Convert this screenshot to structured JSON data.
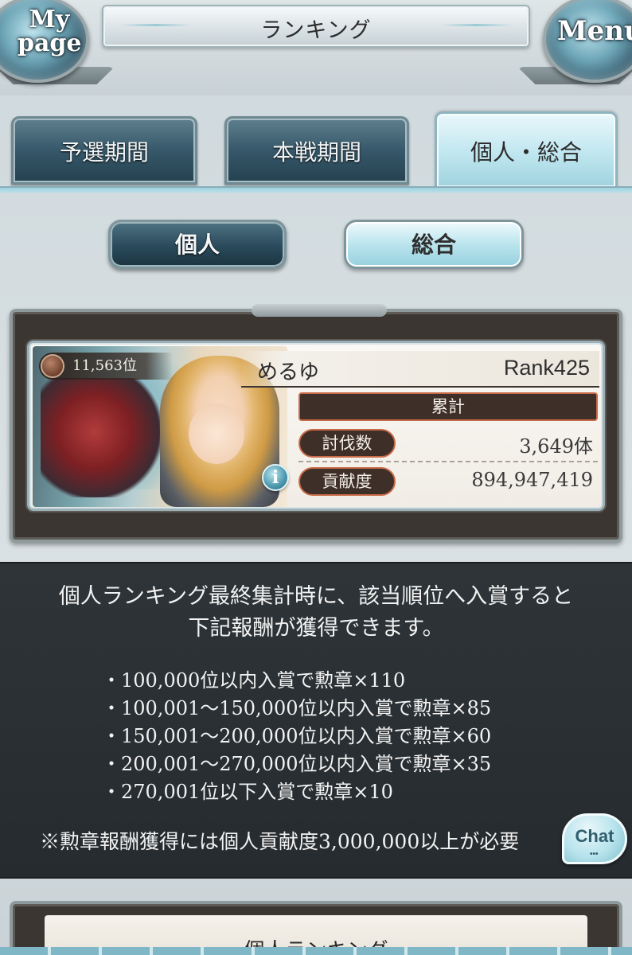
{
  "header": {
    "title": "ランキング",
    "mypage_label": "My page",
    "menu_label": "Menu"
  },
  "tabs": [
    {
      "label": "予選期間",
      "active": false
    },
    {
      "label": "本戦期間",
      "active": false
    },
    {
      "label": "個人・総合",
      "active": true
    }
  ],
  "subtabs": [
    {
      "label": "個人",
      "active": false
    },
    {
      "label": "総合",
      "active": true
    }
  ],
  "player": {
    "rank_position": "11,563位",
    "name": "めるゆ",
    "rank": "Rank425",
    "stats_header": "累計",
    "stats": [
      {
        "label": "討伐数",
        "value": "3,649体"
      },
      {
        "label": "貢献度",
        "value": "894,947,419"
      }
    ],
    "info_icon": "i"
  },
  "info": {
    "intro_line1": "個人ランキング最終集計時に、該当順位へ入賞すると",
    "intro_line2": "下記報酬が獲得できます。",
    "rewards": [
      "100,000位以内入賞で勲章×110",
      "100,001〜150,000位以内入賞で勲章×85",
      "150,001〜200,000位以内入賞で勲章×60",
      "200,001〜270,000位以内入賞で勲章×35",
      "270,001位以下入賞で勲章×10"
    ],
    "note": "※勲章報酬獲得には個人貢献度3,000,000以上が必要"
  },
  "chat": {
    "label": "Chat",
    "dots": "•••"
  },
  "bottom": {
    "title": "個人ランキング"
  },
  "colors": {
    "accent_teal": "#9fd3df",
    "dark_panel": "#2e3438",
    "stat_border": "#c86a48"
  }
}
